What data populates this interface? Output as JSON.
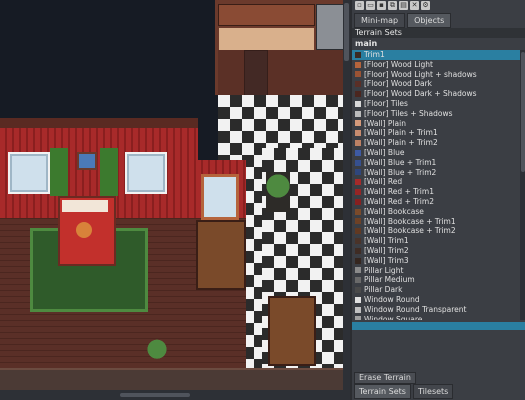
{
  "toolbar": {
    "icons": [
      "new-icon",
      "open-icon",
      "save-icon",
      "copy-icon",
      "paste-icon",
      "delete-icon",
      "settings-icon"
    ]
  },
  "tabs": [
    {
      "label": "Mini-map"
    },
    {
      "label": "Objects"
    }
  ],
  "panel_header": "Terrain Sets",
  "list_title": "main",
  "terrains": [
    {
      "label": "Trim1",
      "color": "#3b2a22",
      "selected": true
    },
    {
      "label": "[Floor] Wood Light",
      "color": "#b5643c"
    },
    {
      "label": "[Floor] Wood Light + shadows",
      "color": "#9a5334"
    },
    {
      "label": "[Floor] Wood Dark",
      "color": "#5a2f27"
    },
    {
      "label": "[Floor] Wood Dark + Shadows",
      "color": "#4b261f"
    },
    {
      "label": "[Floor] Tiles",
      "color": "#d8d8d8"
    },
    {
      "label": "[Floor] Tiles + Shadows",
      "color": "#bcbcbc"
    },
    {
      "label": "[Wall] Plain",
      "color": "#d49a7b"
    },
    {
      "label": "[Wall] Plain + Trim1",
      "color": "#c88c6f"
    },
    {
      "label": "[Wall] Plain + Trim2",
      "color": "#bd8164"
    },
    {
      "label": "[Wall] Blue",
      "color": "#3e5aa3"
    },
    {
      "label": "[Wall] Blue + Trim1",
      "color": "#36508f"
    },
    {
      "label": "[Wall] Blue + Trim2",
      "color": "#2f467c"
    },
    {
      "label": "[Wall] Red",
      "color": "#a52a2a"
    },
    {
      "label": "[Wall] Red + Trim1",
      "color": "#962525"
    },
    {
      "label": "[Wall] Red + Trim2",
      "color": "#872020"
    },
    {
      "label": "[Wall] Bookcase",
      "color": "#7a4a2a"
    },
    {
      "label": "[Wall] Bookcase + Trim1",
      "color": "#6d4126"
    },
    {
      "label": "[Wall] Bookcase + Trim2",
      "color": "#613922"
    },
    {
      "label": "[Wall] Trim1",
      "color": "#4a3329"
    },
    {
      "label": "[Wall] Trim2",
      "color": "#3f2c24"
    },
    {
      "label": "[Wall] Trim3",
      "color": "#35261f"
    },
    {
      "label": "Pillar Light",
      "color": "#8a8a8a"
    },
    {
      "label": "Pillar Medium",
      "color": "#6a6a6a"
    },
    {
      "label": "Pillar Dark",
      "color": "#4a4a4a"
    },
    {
      "label": "Window Round",
      "color": "#e0e0e0"
    },
    {
      "label": "Window Round Transparent",
      "color": "#c0c0c0"
    },
    {
      "label": "Window Square",
      "color": "#a0a0a0"
    }
  ],
  "erase_label": "Erase Terrain",
  "bottom_tabs": [
    {
      "label": "Terrain Sets"
    },
    {
      "label": "Tilesets"
    }
  ]
}
